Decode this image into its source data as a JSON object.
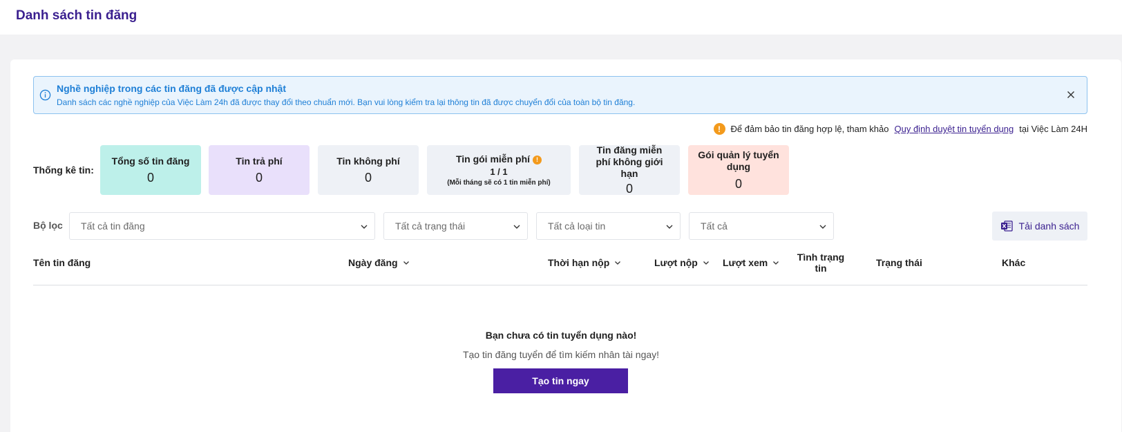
{
  "header": {
    "title": "Danh sách tin đăng"
  },
  "alert": {
    "title": "Nghề nghiệp trong các tin đăng đã được cập nhật",
    "text": "Danh sách các nghề nghiệp của Việc Làm 24h đã được thay đổi theo chuẩn mới. Bạn vui lòng kiểm tra lại thông tin đã được chuyển đổi của toàn bộ tin đăng."
  },
  "notice": {
    "prefix": "Để đảm bảo tin đăng hợp lệ, tham khảo",
    "link": "Quy định duyệt tin tuyển dụng",
    "suffix": "tại Việc Làm 24H"
  },
  "stats": {
    "label": "Thống kê tin:",
    "total": {
      "title": "Tổng số tin đăng",
      "value": "0"
    },
    "paid": {
      "title": "Tin trả phí",
      "value": "0"
    },
    "free": {
      "title": "Tin không phí",
      "value": "0"
    },
    "free_package": {
      "title": "Tin gói miễn phí",
      "ratio": "1 / 1",
      "note": "(Mỗi tháng sẽ có 1 tin miễn phí)"
    },
    "unlimited": {
      "title": "Tin đăng miễn phí không giới hạn",
      "value": "0"
    },
    "management": {
      "title": "Gói quản lý tuyển dụng",
      "value": "0"
    }
  },
  "filters": {
    "label": "Bộ lọc",
    "posts": "Tất cả tin đăng",
    "status": "Tất cả trạng thái",
    "type": "Tất cả loại tin",
    "other": "Tất cả"
  },
  "download_label": "Tải danh sách",
  "table": {
    "col_name": "Tên tin đăng",
    "col_date": "Ngày đăng",
    "col_deadline": "Thời hạn nộp",
    "col_applies": "Lượt nộp",
    "col_views": "Lượt xem",
    "col_condition": "Tình trạng tin",
    "col_status": "Trạng thái",
    "col_other": "Khác"
  },
  "empty": {
    "title": "Bạn chưa có tin tuyển dụng nào!",
    "subtitle": "Tạo tin đăng tuyển để tìm kiếm nhân tài ngay!",
    "cta": "Tạo tin ngay"
  },
  "colors": {
    "brand": "#3a1f8f",
    "cta": "#4a1fa3",
    "alert_text": "#1e7fd6",
    "warning": "#f39a1c"
  },
  "icons": [
    "info-icon",
    "close-icon",
    "warning-icon",
    "chevron-down-icon",
    "excel-icon"
  ]
}
